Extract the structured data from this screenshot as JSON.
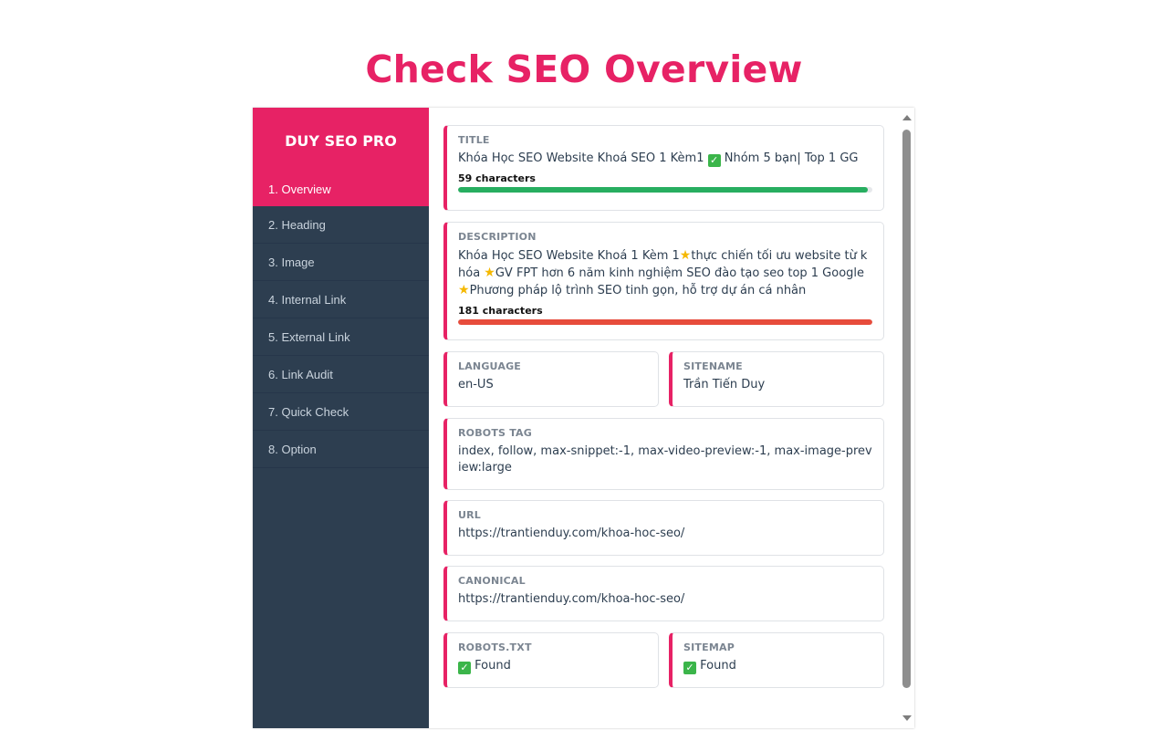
{
  "page": {
    "title": "Check SEO Overview"
  },
  "sidebar": {
    "brand": "DUY SEO PRO",
    "items": [
      {
        "label": "1. Overview",
        "active": true
      },
      {
        "label": "2. Heading"
      },
      {
        "label": "3. Image"
      },
      {
        "label": "4. Internal Link"
      },
      {
        "label": "5. External Link"
      },
      {
        "label": "6. Link Audit"
      },
      {
        "label": "7. Quick Check"
      },
      {
        "label": "8. Option"
      }
    ]
  },
  "overview": {
    "title": {
      "label": "TITLE",
      "text_before": "Khóa Học SEO Website Khoá SEO 1 Kèm1",
      "text_after": "Nhóm 5 bạn| Top 1 GG",
      "count": "59 characters",
      "progress": 0.99,
      "bar_color": "#27ae60"
    },
    "description": {
      "label": "DESCRIPTION",
      "seg1": "Khóa Học SEO Website Khoá 1 Kèm 1",
      "seg2": "thực chiến tối ưu website từ khóa ",
      "seg3": "GV FPT hơn 6 năm kinh nghiệm SEO đào tạo seo top 1 Google",
      "seg4": "Phương pháp lộ trình SEO tinh gọn, hỗ trợ dự án cá nhân",
      "count": "181 characters",
      "progress": 1.0,
      "bar_color": "#e74c3c"
    },
    "language": {
      "label": "LANGUAGE",
      "value": "en-US"
    },
    "sitename": {
      "label": "SITENAME",
      "value": "Trần Tiến Duy"
    },
    "robots_tag": {
      "label": "ROBOTS TAG",
      "value": "index, follow, max-snippet:-1, max-video-preview:-1, max-image-preview:large"
    },
    "url": {
      "label": "URL",
      "value": "https://trantienduy.com/khoa-hoc-seo/"
    },
    "canonical": {
      "label": "CANONICAL",
      "value": "https://trantienduy.com/khoa-hoc-seo/"
    },
    "robots_txt": {
      "label": "ROBOTS.TXT",
      "value": "Found"
    },
    "sitemap": {
      "label": "SITEMAP",
      "value": "Found"
    }
  },
  "icons": {
    "check": "check-mark-icon",
    "star": "star-icon"
  },
  "colors": {
    "accent": "#e72265",
    "sidebar_bg": "#2d3e50",
    "success": "#27ae60",
    "danger": "#e74c3c"
  }
}
